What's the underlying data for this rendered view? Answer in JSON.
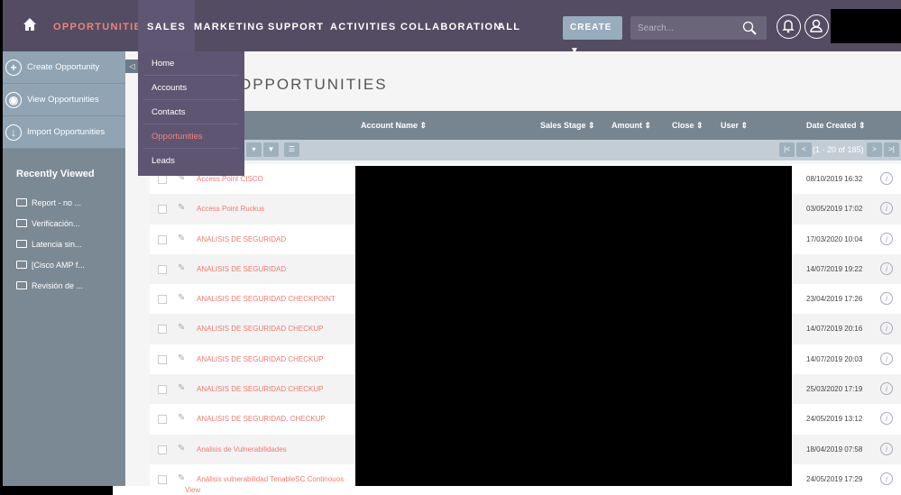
{
  "nav": {
    "items": [
      "OPPORTUNITIES",
      "SALES",
      "MARKETING",
      "SUPPORT",
      "ACTIVITIES",
      "COLLABORATION",
      "ALL"
    ],
    "create_label": "CREATE ▼",
    "search_placeholder": "Search..."
  },
  "sales_menu": [
    "Home",
    "Accounts",
    "Contacts",
    "Opportunities",
    "Leads"
  ],
  "sidebar": {
    "actions": [
      "Create Opportunity",
      "View Opportunities",
      "Import Opportunities"
    ],
    "recently_viewed_title": "Recently Viewed",
    "recent": [
      "Report - no ...",
      "Verificación...",
      "Latencia sin...",
      "[Cisco AMP f...",
      "Revisión de ..."
    ]
  },
  "page_title": "OPPORTUNITIES",
  "table": {
    "headers": [
      "Account Name",
      "Sales Stage",
      "Amount",
      "Close",
      "User",
      "Date Created"
    ],
    "pagination": "(1 - 20 of 185)",
    "rows": [
      {
        "name": "Access Point CISCO",
        "date": "08/10/2019 16:32"
      },
      {
        "name": "Access Point Ruckus",
        "date": "03/05/2019 17:02"
      },
      {
        "name": "ANALISIS DE SEGURIDAD",
        "date": "17/03/2020 10:04"
      },
      {
        "name": "ANALISIS DE SEGURIDAD",
        "date": "14/07/2019 19:22"
      },
      {
        "name": "ANALISIS DE SEGURIDAD CHECKPOINT",
        "date": "23/04/2019 17:26"
      },
      {
        "name": "ANALISIS DE SEGURIDAD CHECKUP",
        "date": "14/07/2019 20:16"
      },
      {
        "name": "ANALISIS DE SEGURIDAD CHECKUP",
        "date": "14/07/2019 20:03"
      },
      {
        "name": "ANALISIS DE SEGURIDAD CHECKUP",
        "date": "25/03/2020 17:19"
      },
      {
        "name": "ANALISIS DE SEGURIDAD, CHECKUP",
        "date": "24/05/2019 13:12"
      },
      {
        "name": "Analisis de Vulnerabilidades",
        "date": "18/04/2019 07:58"
      },
      {
        "name": "Análisis vulnerabilidad TenableSC Continouos",
        "date": "24/05/2019 17:29"
      }
    ]
  },
  "bottom_text": "View",
  "colors": {
    "nav": "#534c63",
    "accent": "#f08377",
    "sidebar": "#90a4b4"
  }
}
